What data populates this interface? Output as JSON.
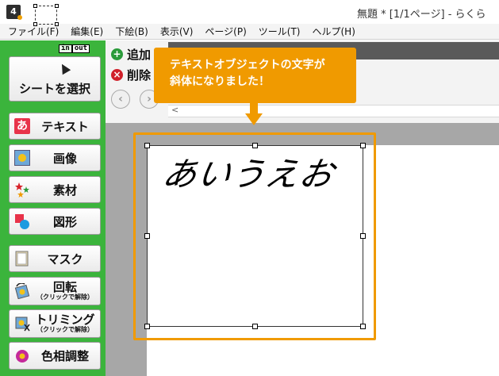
{
  "window": {
    "title": "無題 *  [1/1ページ] - らくら"
  },
  "menu": {
    "items": [
      "ファイル(F)",
      "編集(E)",
      "下絵(B)",
      "表示(V)",
      "ページ(P)",
      "ツール(T)",
      "ヘルプ(H)"
    ]
  },
  "sidebar": {
    "in_label": "in",
    "out_label": "out",
    "select_label": "シートを選択",
    "text_icon_char": "あ",
    "items": {
      "text": "テキスト",
      "image": "画像",
      "material": "素材",
      "shape": "図形",
      "mask": "マスク",
      "rotate": "回転",
      "rotate_sub": "（クリックで解除）",
      "trim": "トリミング",
      "trim_sub": "（クリックで解除）",
      "hue": "色相調整"
    }
  },
  "toolbar": {
    "add_label": "追加",
    "delete_label": "削除",
    "add_icon": "+",
    "delete_icon": "×",
    "back_arrow": "‹",
    "forward_arrow": "›",
    "scroll_arrow": "<"
  },
  "canvas": {
    "text_object": "あいうえお"
  },
  "callout": {
    "line1": "テキストオブジェクトの文字が",
    "line2": "斜体になりました！"
  },
  "colors": {
    "sidebar_green": "#3bb43c",
    "callout_orange": "#f09a00",
    "add_green": "#2a9a3a",
    "delete_red": "#d0202a",
    "canvas_gray": "#a7a7a7"
  }
}
